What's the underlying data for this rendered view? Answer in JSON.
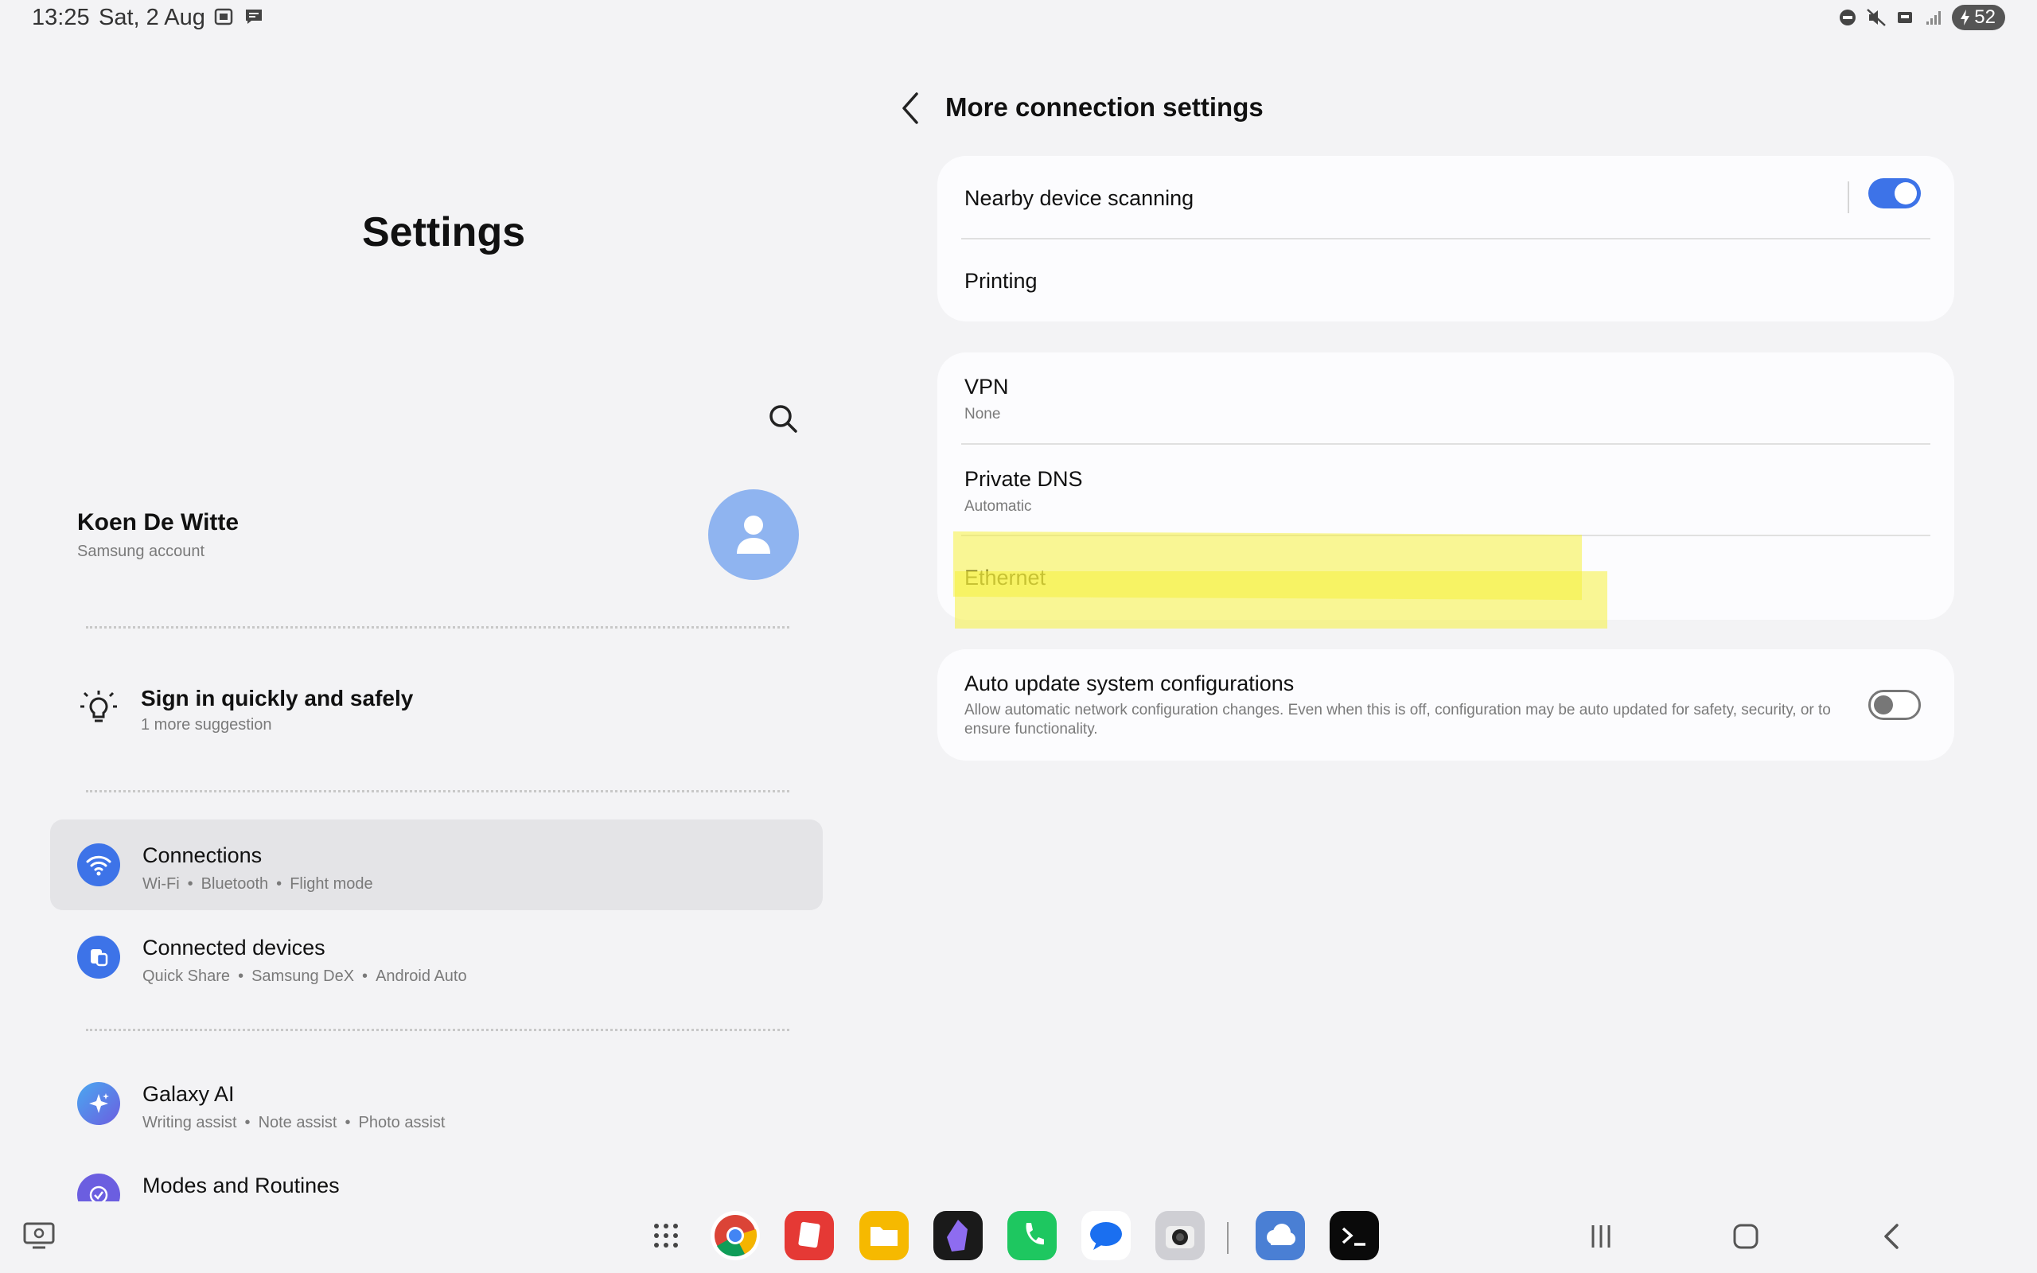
{
  "status_bar": {
    "time": "13:25",
    "date": "Sat, 2 Aug",
    "battery": "52"
  },
  "left": {
    "title": "Settings",
    "account": {
      "name": "Koen De Witte",
      "sub": "Samsung account"
    },
    "suggestion": {
      "title": "Sign in quickly and safely",
      "sub": "1 more suggestion"
    },
    "menu": [
      {
        "title": "Connections",
        "subs": [
          "Wi-Fi",
          "Bluetooth",
          "Flight mode"
        ],
        "color": "#3d73e8",
        "icon": "wifi-icon"
      },
      {
        "title": "Connected devices",
        "subs": [
          "Quick Share",
          "Samsung DeX",
          "Android Auto"
        ],
        "color": "#3d73e8",
        "icon": "connected-devices-icon"
      },
      {
        "title": "Galaxy AI",
        "subs": [
          "Writing assist",
          "Note assist",
          "Photo assist"
        ],
        "color": "#5b6ff0",
        "icon": "galaxy-ai-icon"
      },
      {
        "title": "Modes and Routines",
        "subs": [],
        "color": "#6b5ee0",
        "icon": "modes-icon"
      }
    ]
  },
  "right": {
    "title": "More connection settings",
    "card1": [
      {
        "title": "Nearby device scanning",
        "toggle": "on"
      },
      {
        "title": "Printing"
      }
    ],
    "card2": [
      {
        "title": "VPN",
        "sub": "None"
      },
      {
        "title": "Private DNS",
        "sub": "Automatic"
      },
      {
        "title": "Ethernet"
      }
    ],
    "card3": {
      "title": "Auto update system configurations",
      "sub": "Allow automatic network configuration changes. Even when this is off, configuration may be auto updated for safety, security, or to ensure functionality.",
      "toggle": "off"
    }
  },
  "taskbar": {
    "apps": [
      "app-drawer",
      "chrome",
      "notes",
      "my-files",
      "obsidian",
      "phone",
      "messages",
      "camera",
      "onedrive",
      "terminal"
    ]
  },
  "colors": {
    "accent": "#3d73e8",
    "highlight": "#f5f03c",
    "background": "#f3f3f5",
    "card": "#fcfcfe"
  }
}
